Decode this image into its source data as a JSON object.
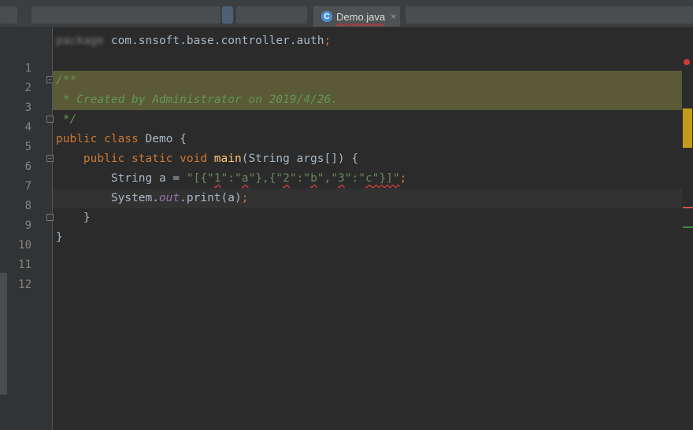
{
  "editor": {
    "tab": {
      "icon": "class-icon",
      "icon_glyph": "C",
      "label": "Demo.java",
      "close": "×"
    },
    "lines": [
      {
        "num": "1",
        "tokens": [
          {
            "t": "package",
            "c": "kw blurred"
          },
          {
            "t": " com.snsoft.base.controller.auth",
            "c": ""
          },
          {
            "t": ";",
            "c": "kw"
          }
        ]
      },
      {
        "num": "2",
        "tokens": []
      },
      {
        "num": "3",
        "tokens": [
          {
            "t": "/**",
            "c": "doc"
          }
        ]
      },
      {
        "num": "4",
        "tokens": [
          {
            "t": " * Created by Administrator on 2019/4/26.",
            "c": "doc"
          }
        ]
      },
      {
        "num": "5",
        "tokens": [
          {
            "t": " */",
            "c": "doc"
          }
        ]
      },
      {
        "num": "6",
        "tokens": [
          {
            "t": "public class ",
            "c": "kw"
          },
          {
            "t": "Demo {",
            "c": ""
          }
        ]
      },
      {
        "num": "7",
        "tokens": [
          {
            "t": "    public static void ",
            "c": "kw"
          },
          {
            "t": "main",
            "c": "fn"
          },
          {
            "t": "(String args[]) {",
            "c": ""
          }
        ]
      },
      {
        "num": "8",
        "tokens": [
          {
            "t": "        String a = ",
            "c": ""
          },
          {
            "t": "\"[{\"",
            "c": "str"
          },
          {
            "t": "1",
            "c": "str wavy"
          },
          {
            "t": "\":\"",
            "c": "str"
          },
          {
            "t": "a",
            "c": "str wavy"
          },
          {
            "t": "\"},{\"",
            "c": "str"
          },
          {
            "t": "2",
            "c": "str wavy"
          },
          {
            "t": "\":\"",
            "c": "str"
          },
          {
            "t": "b",
            "c": "str wavy"
          },
          {
            "t": "\",\"",
            "c": "str"
          },
          {
            "t": "3",
            "c": "str wavy"
          },
          {
            "t": "\":\"",
            "c": "str"
          },
          {
            "t": "c",
            "c": "str wavy"
          },
          {
            "t": "\"}]\"",
            "c": "str wavy"
          },
          {
            "t": ";",
            "c": "kw"
          }
        ]
      },
      {
        "num": "9",
        "tokens": [
          {
            "t": "        System.",
            "c": ""
          },
          {
            "t": "out",
            "c": "field"
          },
          {
            "t": ".print(a)",
            "c": ""
          },
          {
            "t": ";",
            "c": "kw"
          }
        ]
      },
      {
        "num": "10",
        "tokens": [
          {
            "t": "    }",
            "c": ""
          }
        ]
      },
      {
        "num": "11",
        "tokens": [
          {
            "t": "}",
            "c": ""
          }
        ]
      },
      {
        "num": "12",
        "tokens": []
      }
    ],
    "markers": {
      "error_icon": "error-stripe-icon"
    }
  }
}
